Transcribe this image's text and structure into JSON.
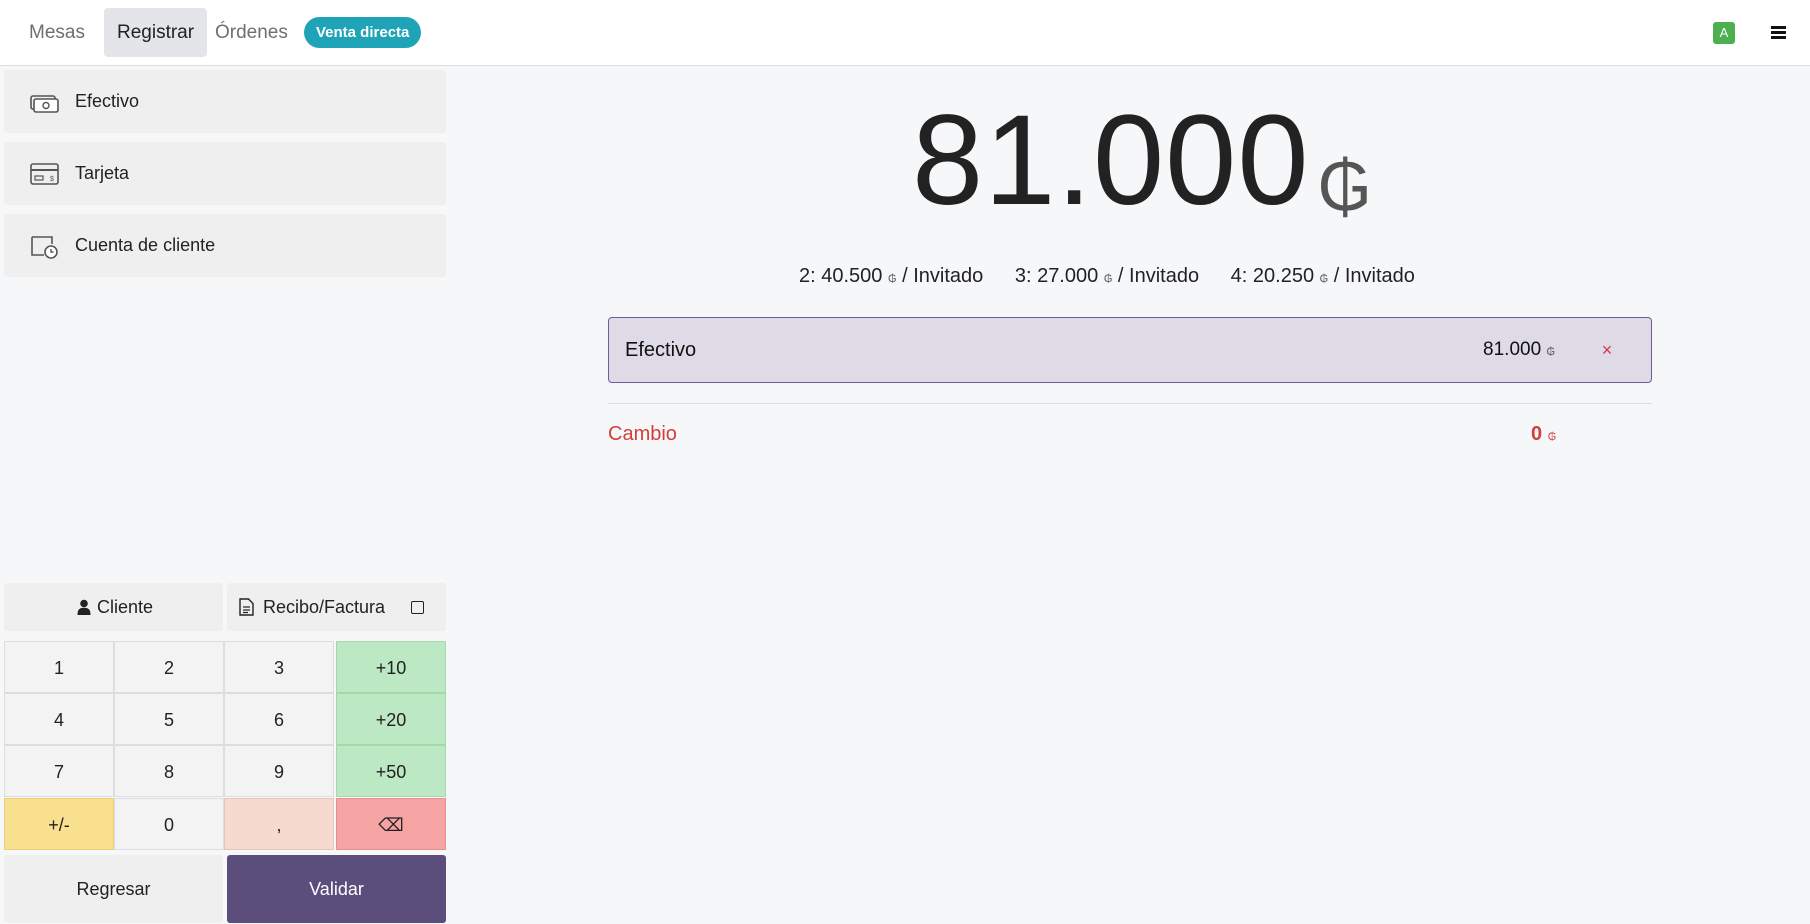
{
  "nav": {
    "tabs": [
      {
        "label": "Mesas"
      },
      {
        "label": "Registrar"
      },
      {
        "label": "Órdenes"
      }
    ],
    "badge": "Venta directa",
    "avatar": "A",
    "menu_icon": "hamburger-icon"
  },
  "payment_methods": [
    {
      "label": "Efectivo",
      "icon": "cash-icon"
    },
    {
      "label": "Tarjeta",
      "icon": "card-icon"
    },
    {
      "label": "Cuenta de cliente",
      "icon": "customer-account-icon"
    }
  ],
  "actions": {
    "customer": "Cliente",
    "invoice": "Recibo/Factura"
  },
  "numpad": {
    "keys": [
      "1",
      "2",
      "3",
      "+10",
      "4",
      "5",
      "6",
      "+20",
      "7",
      "8",
      "9",
      "+50",
      "+/-",
      "0",
      ",",
      "⌫"
    ]
  },
  "footer": {
    "back": "Regresar",
    "validate": "Validar"
  },
  "total": {
    "amount": "81.000",
    "currency": "₲"
  },
  "splits": [
    {
      "label": "2: 40.500",
      "currency": "₲",
      "suffix": " / Invitado"
    },
    {
      "label": "3: 27.000",
      "currency": "₲",
      "suffix": " / Invitado"
    },
    {
      "label": "4: 20.250",
      "currency": "₲",
      "suffix": " / Invitado"
    }
  ],
  "payment_line": {
    "name": "Efectivo",
    "amount": "81.000",
    "currency": "₲",
    "delete": "×"
  },
  "change": {
    "label": "Cambio",
    "value": "0",
    "currency": "₲"
  },
  "colors": {
    "accent": "#5b4d7c",
    "badge": "#1fa4b7",
    "change": "#d23f3a"
  }
}
